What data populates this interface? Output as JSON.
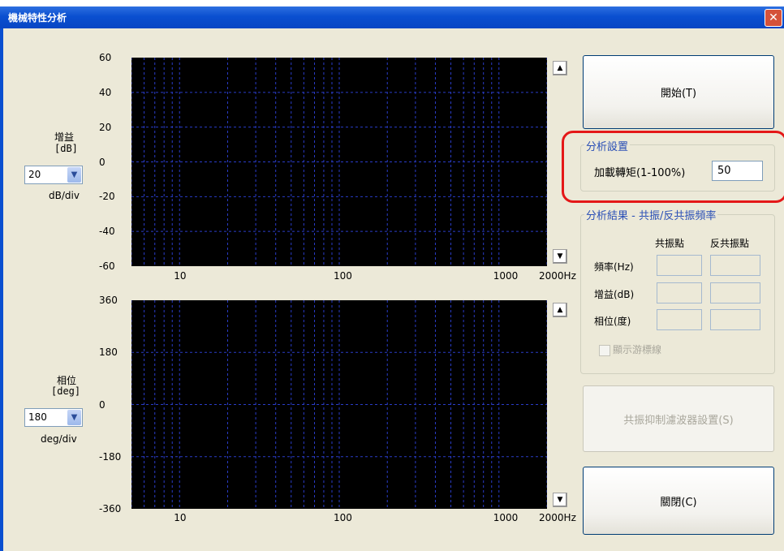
{
  "window": {
    "title": "機械特性分析"
  },
  "gain_plot": {
    "axis_label": "增益",
    "axis_unit": "[dB]",
    "y_ticks": [
      "60",
      "40",
      "20",
      "0",
      "-20",
      "-40",
      "-60"
    ],
    "x_ticks": [
      "10",
      "100",
      "1000",
      "2000Hz"
    ],
    "scale_value": "20",
    "scale_unit": "dB/div"
  },
  "phase_plot": {
    "axis_label": "相位",
    "axis_unit": "[deg]",
    "y_ticks": [
      "360",
      "180",
      "0",
      "-180",
      "-360"
    ],
    "x_ticks": [
      "10",
      "100",
      "1000",
      "2000Hz"
    ],
    "scale_value": "180",
    "scale_unit": "deg/div"
  },
  "scroll": {
    "up": "▲",
    "down": "▼"
  },
  "buttons": {
    "start": "開始(T)",
    "filter_settings": "共振抑制濾波器設置(S)",
    "close": "關閉(C)"
  },
  "analysis_settings": {
    "title": "分析設置",
    "torque_label": "加載轉矩(1-100%)",
    "torque_value": "50"
  },
  "analysis_results": {
    "title": "分析結果 - 共振/反共振頻率",
    "col_resonance": "共振點",
    "col_antiresonance": "反共振點",
    "row_freq": "頻率(Hz)",
    "row_gain": "增益(dB)",
    "row_phase": "相位(度)",
    "show_cursor_label": "顯示游標線"
  },
  "colors": {
    "grid": "#2a3cc8",
    "highlight": "#e41818",
    "title_bar": "#0a4fd0"
  }
}
